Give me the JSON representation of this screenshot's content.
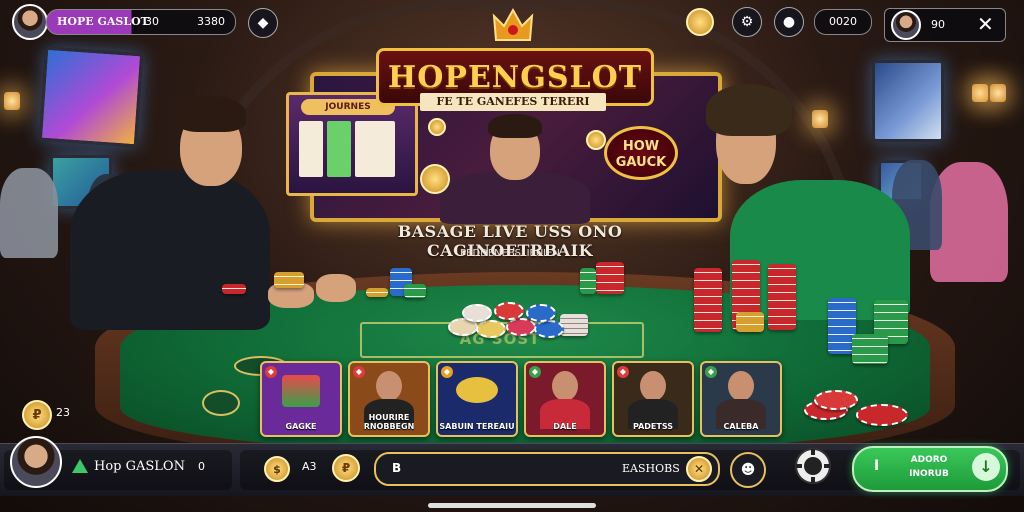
{
  "top_bar": {
    "brand_label": "HOPE GASLOT",
    "balance_value": "30",
    "coins_value": "3380",
    "timer_value": "0020",
    "right_counter_value": "90"
  },
  "banner": {
    "logo_text": "HOPENGSLOT",
    "tagline": "FE TE GANEFES TERERI",
    "mini_slot_title": "JOURNES",
    "badge_text": "HOW GAUCK"
  },
  "table": {
    "title": "BASAGE LIVE USS ONO CAGINOETRBAIK",
    "subtitle": "PEDDENEBSLIEUIEN",
    "felt_text": "AG SOST"
  },
  "game_cards": [
    {
      "label": "GAGKE",
      "bg": "#6a2a9a"
    },
    {
      "label": "HOURIRE RNOBBEGN",
      "bg": "#8a4a1a"
    },
    {
      "label": "SABUIN TEREAIU",
      "bg": "#1a2a6a"
    },
    {
      "label": "DALE",
      "bg": "#7a1a2a"
    },
    {
      "label": "PADETSS",
      "bg": "#3a2a1a"
    },
    {
      "label": "CALEBA",
      "bg": "#2a3a4a"
    }
  ],
  "left_side": {
    "mini_value": "23"
  },
  "bottom_bar": {
    "player_name": "Hop GASLON",
    "player_suffix": "0",
    "bet_value": "A3",
    "search_prefix": "B",
    "search_value": "EASHOBS",
    "action_button_line1": "ADORO",
    "action_button_line2": "INORUB"
  },
  "colors": {
    "felt": "#0f6a36",
    "gold": "#d8a838",
    "action_green": "#1e9a3a",
    "brand_purple": "#9a3ab8"
  }
}
